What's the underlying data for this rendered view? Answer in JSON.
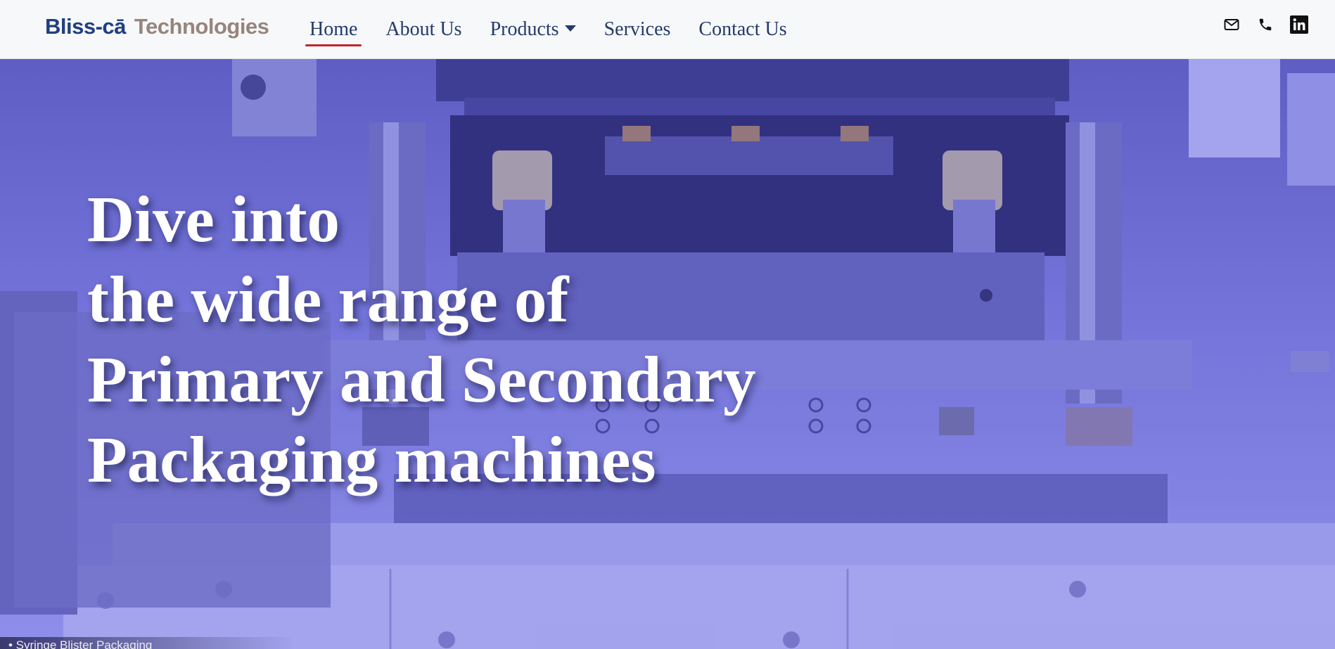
{
  "brand": {
    "part1": "Bliss-cā",
    "part2": "Technologies",
    "color_primary": "#1f3f80",
    "color_secondary": "#96857d"
  },
  "nav": {
    "items": [
      {
        "label": "Home",
        "active": true
      },
      {
        "label": "About Us",
        "active": false
      },
      {
        "label": "Products",
        "active": false,
        "dropdown": true
      },
      {
        "label": "Services",
        "active": false
      },
      {
        "label": "Contact Us",
        "active": false
      }
    ],
    "active_underline_color": "#c4242b",
    "icons": [
      "envelope-icon",
      "phone-icon",
      "linkedin-icon"
    ]
  },
  "hero": {
    "lines": [
      "Dive into",
      "the wide range of",
      "Primary and Secondary",
      "Packaging machines"
    ],
    "caption": "• Syringe Blister Packaging",
    "tint_color": "#7a7ad8"
  }
}
